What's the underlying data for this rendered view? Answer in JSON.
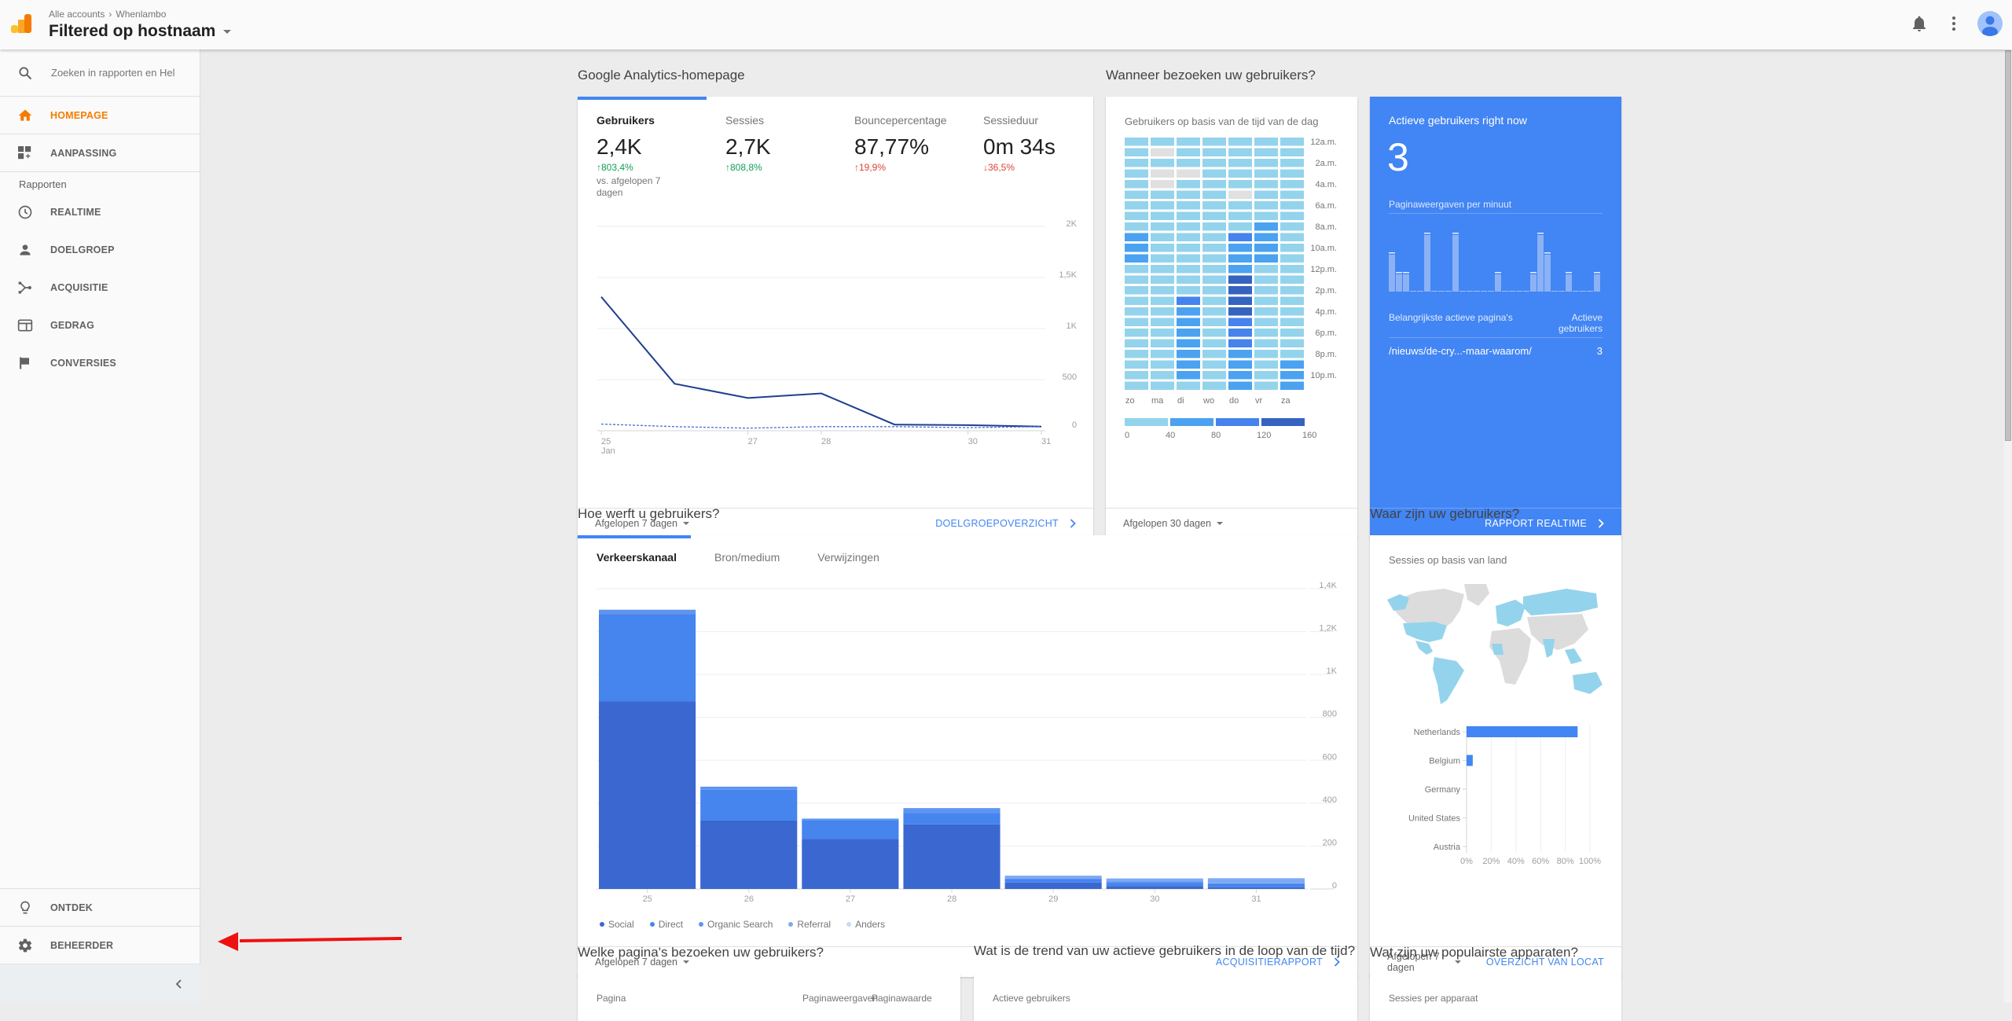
{
  "header": {
    "breadcrumb": [
      "Alle accounts",
      "Whenlambo"
    ],
    "view_title": "Filtered op hostnaam",
    "icons": [
      "analytics-logo-icon",
      "notifications-bell-icon",
      "more-vert-icon",
      "account-avatar-icon"
    ]
  },
  "sidebar": {
    "search_placeholder": "Zoeken in rapporten en Hel",
    "top_items": [
      {
        "label": "HOMEPAGE",
        "icon": "home-icon",
        "active": true
      },
      {
        "label": "AANPASSING",
        "icon": "dashboard-add-icon",
        "active": false
      }
    ],
    "section_label": "Rapporten",
    "report_items": [
      {
        "label": "REALTIME",
        "icon": "clock-icon"
      },
      {
        "label": "DOELGROEP",
        "icon": "person-icon"
      },
      {
        "label": "ACQUISITIE",
        "icon": "acquisition-icon"
      },
      {
        "label": "GEDRAG",
        "icon": "behavior-icon"
      },
      {
        "label": "CONVERSIES",
        "icon": "flag-icon"
      }
    ],
    "bottom_items": [
      {
        "label": "ONTDEK",
        "icon": "lightbulb-icon"
      },
      {
        "label": "BEHEERDER",
        "icon": "gear-icon"
      }
    ],
    "collapse_icon": "chevron-left-icon"
  },
  "overview": {
    "section_title": "Google Analytics-homepage",
    "kpis": [
      {
        "label": "Gebruikers",
        "value": "2,4K",
        "delta": "↑803,4%",
        "delta_type": "good",
        "compare": "vs. afgelopen 7 dagen",
        "active": true
      },
      {
        "label": "Sessies",
        "value": "2,7K",
        "delta": "↑808,8%",
        "delta_type": "good"
      },
      {
        "label": "Bouncepercentage",
        "value": "87,77%",
        "delta": "↑19,9%",
        "delta_type": "bad"
      },
      {
        "label": "Sessieduur",
        "value": "0m 34s",
        "delta": "↓36,5%",
        "delta_type": "bad"
      }
    ],
    "range_label": "Afgelopen 7 dagen",
    "link_label": "DOELGROEPOVERZICHT"
  },
  "when": {
    "section_title": "Wanneer bezoeken uw gebruikers?",
    "card_title": "Gebruikers op basis van de tijd van de dag",
    "range_label": "Afgelopen 30 dagen"
  },
  "realtime": {
    "title": "Actieve gebruikers right now",
    "value": "3",
    "subtitle": "Paginaweergaven per minuut",
    "pageviews_per_minute": [
      2,
      1,
      1,
      0,
      0,
      3,
      0,
      0,
      0,
      3,
      0,
      0,
      0,
      0,
      0,
      1,
      0,
      0,
      0,
      0,
      1,
      3,
      2,
      0,
      0,
      1,
      0,
      0,
      0,
      1
    ],
    "pages_header": "Belangrijkste actieve pagina's",
    "users_header": "Actieve gebruikers",
    "rows": [
      {
        "page": "/nieuws/de-cry...-maar-waarom/",
        "users": "3"
      }
    ],
    "link_label": "RAPPORT REALTIME"
  },
  "acquisition": {
    "section_title": "Hoe werft u gebruikers?",
    "tabs": [
      "Verkeerskanaal",
      "Bron/medium",
      "Verwijzingen"
    ],
    "active_tab": 0,
    "range_label": "Afgelopen 7 dagen",
    "link_label": "ACQUISITIERAPPORT"
  },
  "geo": {
    "section_title": "Waar zijn uw gebruikers?",
    "card_title": "Sessies op basis van land",
    "range_label": "Afgelopen 7 dagen",
    "link_label": "OVERZICHT VAN LOCAT"
  },
  "bottom_sections": {
    "pages": {
      "title": "Welke pagina's bezoeken uw gebruikers?",
      "columns": [
        "Pagina",
        "Paginaweergaven",
        "Paginawaarde"
      ]
    },
    "trend": {
      "title": "Wat is de trend van uw actieve gebruikers in de loop van de tijd?",
      "card_title": "Actieve gebruikers"
    },
    "devices": {
      "title": "Wat zijn uw populairste apparaten?",
      "card_title": "Sessies per apparaat"
    }
  },
  "chart_data": [
    {
      "id": "users-line",
      "type": "line",
      "title": "Gebruikers",
      "x": [
        "25",
        "26",
        "27",
        "28",
        "29",
        "30",
        "31"
      ],
      "x_tick_labels": [
        {
          "x": "25",
          "label": "25",
          "sub": "Jan"
        },
        {
          "x": "27",
          "label": "27"
        },
        {
          "x": "28",
          "label": "28"
        },
        {
          "x": "30",
          "label": "30"
        },
        {
          "x": "31",
          "label": "31"
        }
      ],
      "series": [
        {
          "name": "Gebruikers (afgelopen 7 dagen)",
          "style": "solid",
          "color": "#1f3f8f",
          "values": [
            1310,
            460,
            320,
            365,
            60,
            55,
            40
          ]
        },
        {
          "name": "Gebruikers (vorige periode)",
          "style": "dashed",
          "color": "#4a6fd1",
          "values": [
            65,
            40,
            25,
            40,
            40,
            30,
            40
          ]
        }
      ],
      "ylim": [
        0,
        2000
      ],
      "y_ticks": [
        "0",
        "500",
        "1K",
        "1,5K",
        "2K"
      ],
      "y_tick_values": [
        0,
        500,
        1000,
        1500,
        2000
      ],
      "grid": true,
      "y_axis_side": "right"
    },
    {
      "id": "time-heatmap",
      "type": "heatmap",
      "title": "Gebruikers op basis van de tijd van de dag",
      "columns": [
        "zo",
        "ma",
        "di",
        "wo",
        "do",
        "vr",
        "za"
      ],
      "row_labels": [
        "12a.m.",
        "",
        "2a.m.",
        "",
        "4a.m.",
        "",
        "6a.m.",
        "",
        "8a.m.",
        "",
        "10a.m.",
        "",
        "12p.m.",
        "",
        "2p.m.",
        "",
        "4p.m.",
        "",
        "6p.m.",
        "",
        "8p.m.",
        "",
        "10p.m.",
        ""
      ],
      "levels": [
        [
          1,
          1,
          1,
          1,
          1,
          1,
          1
        ],
        [
          1,
          0,
          1,
          1,
          1,
          1,
          1
        ],
        [
          1,
          1,
          1,
          1,
          1,
          1,
          1
        ],
        [
          1,
          0,
          0,
          1,
          1,
          1,
          1
        ],
        [
          1,
          0,
          1,
          1,
          1,
          1,
          1
        ],
        [
          1,
          1,
          1,
          1,
          0,
          1,
          1
        ],
        [
          1,
          1,
          1,
          1,
          1,
          1,
          1
        ],
        [
          1,
          1,
          1,
          1,
          1,
          1,
          1
        ],
        [
          1,
          1,
          1,
          1,
          1,
          2,
          1
        ],
        [
          2,
          1,
          1,
          1,
          3,
          2,
          1
        ],
        [
          2,
          1,
          1,
          1,
          2,
          2,
          1
        ],
        [
          2,
          1,
          1,
          1,
          2,
          2,
          1
        ],
        [
          1,
          1,
          1,
          1,
          2,
          1,
          1
        ],
        [
          1,
          1,
          1,
          1,
          4,
          1,
          1
        ],
        [
          1,
          1,
          1,
          1,
          4,
          1,
          1
        ],
        [
          1,
          1,
          3,
          1,
          4,
          1,
          1
        ],
        [
          1,
          1,
          2,
          1,
          4,
          1,
          1
        ],
        [
          1,
          1,
          2,
          1,
          3,
          1,
          1
        ],
        [
          1,
          1,
          2,
          1,
          3,
          1,
          1
        ],
        [
          1,
          1,
          2,
          1,
          3,
          1,
          1
        ],
        [
          1,
          1,
          2,
          1,
          2,
          1,
          1
        ],
        [
          1,
          1,
          2,
          1,
          2,
          1,
          2
        ],
        [
          1,
          1,
          2,
          1,
          2,
          1,
          2
        ],
        [
          1,
          1,
          1,
          1,
          2,
          1,
          2
        ]
      ],
      "level_colors": [
        "#e0e0e0",
        "#94d3ec",
        "#4aa2f1",
        "#4683ec",
        "#3563c0"
      ],
      "scale_ticks": [
        "0",
        "40",
        "80",
        "120",
        "160"
      ]
    },
    {
      "id": "realtime-bars",
      "type": "bar",
      "title": "Paginaweergaven per minuut",
      "values": [
        2,
        1,
        1,
        0,
        0,
        3,
        0,
        0,
        0,
        3,
        0,
        0,
        0,
        0,
        0,
        1,
        0,
        0,
        0,
        0,
        1,
        3,
        2,
        0,
        0,
        1,
        0,
        0,
        0,
        1
      ],
      "ylim": [
        0,
        3.5
      ]
    },
    {
      "id": "acquisition-stacked-bar",
      "type": "bar",
      "stacked": true,
      "categories": [
        "25",
        "26",
        "27",
        "28",
        "29",
        "30",
        "31"
      ],
      "category_sub": {
        "25": "Jan"
      },
      "series": [
        {
          "name": "Social",
          "color": "#3a68d0",
          "values": [
            874,
            319,
            233,
            301,
            30,
            14,
            8
          ]
        },
        {
          "name": "Direct",
          "color": "#4684ee",
          "values": [
            407,
            144,
            86,
            54,
            14,
            15,
            16
          ]
        },
        {
          "name": "Organic Search",
          "color": "#5f95f0",
          "values": [
            21,
            14,
            9,
            22,
            6,
            6,
            2
          ]
        },
        {
          "name": "Referral",
          "color": "#7eaaf3",
          "values": [
            0,
            0,
            0,
            0,
            12,
            14,
            24
          ]
        },
        {
          "name": "Anders",
          "color": "#c8daf9",
          "values": [
            0,
            0,
            0,
            0,
            0,
            0,
            0
          ]
        }
      ],
      "ylim": [
        0,
        1400
      ],
      "y_ticks": [
        "0",
        "200",
        "400",
        "600",
        "800",
        "1K",
        "1,2K",
        "1,4K"
      ],
      "y_tick_values": [
        0,
        200,
        400,
        600,
        800,
        1000,
        1200,
        1400
      ],
      "grid": true,
      "legend": "bottom-left"
    },
    {
      "id": "country-bar",
      "type": "bar",
      "orientation": "horizontal",
      "categories": [
        "Netherlands",
        "Belgium",
        "Germany",
        "United States",
        "Austria"
      ],
      "values": [
        90,
        5,
        0.3,
        0.2,
        0.2
      ],
      "unit": "%",
      "xlim": [
        0,
        100
      ],
      "x_ticks": [
        "0%",
        "20%",
        "40%",
        "60%",
        "80%",
        "100%"
      ],
      "color": "#4285f4"
    }
  ]
}
